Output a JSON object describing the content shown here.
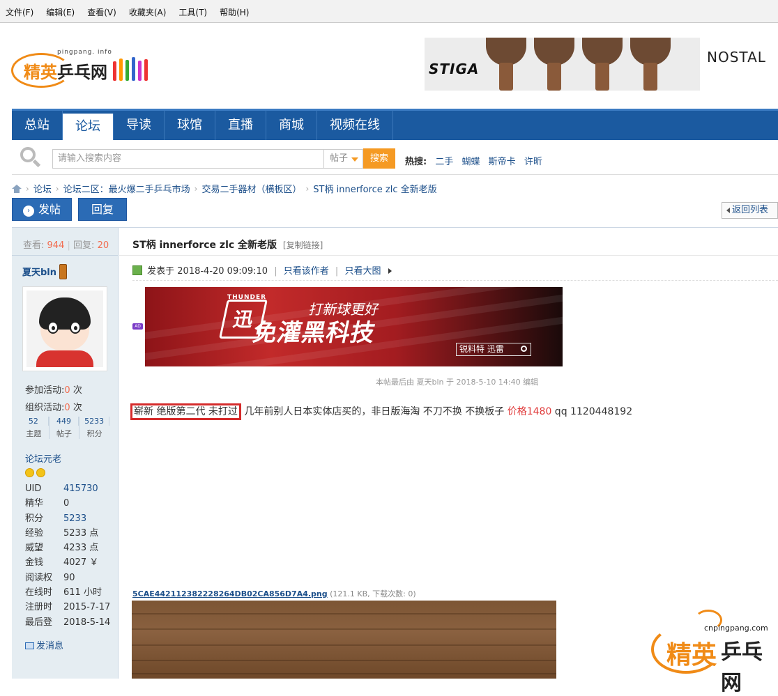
{
  "menubar": {
    "items": [
      "文件(F)",
      "编辑(E)",
      "查看(V)",
      "收藏夹(A)",
      "工具(T)",
      "帮助(H)"
    ]
  },
  "logo": {
    "site": "pingpang. info",
    "jing": "精英",
    "pp": "乒乓网"
  },
  "ad_top": {
    "brand": "STIGA",
    "side_text": "NOSTAL"
  },
  "nav": {
    "items": [
      "总站",
      "论坛",
      "导读",
      "球馆",
      "直播",
      "商城",
      "视频在线"
    ],
    "active": "论坛"
  },
  "search": {
    "placeholder": "请输入搜索内容",
    "type": "帖子",
    "button": "搜索",
    "hot_label": "热搜:",
    "hot_items": [
      "二手",
      "蝴蝶",
      "斯帝卡",
      "许昕"
    ]
  },
  "breadcrumb": {
    "items": [
      "论坛",
      "论坛二区：最火爆二手乒乓市场",
      "交易二手器材（横板区）",
      "ST柄 innerforce zlc 全新老版"
    ]
  },
  "actions": {
    "post": "发帖",
    "reply": "回复",
    "back": "返回列表"
  },
  "sidebar": {
    "views_label": "查看:",
    "views": "944",
    "replies_label": "回复:",
    "replies": "20",
    "username": "夏天bln",
    "activity_participate_label": "参加活动:",
    "activity_participate": "0",
    "activity_organize_label": "组织活动:",
    "activity_organize": "0",
    "activity_unit": "次",
    "counts": [
      {
        "n": "52",
        "l": "主题"
      },
      {
        "n": "449",
        "l": "帖子"
      },
      {
        "n": "5233",
        "l": "积分"
      }
    ],
    "rank": "论坛元老",
    "info": [
      {
        "k": "UID",
        "v": "415730"
      },
      {
        "k": "精华",
        "v": "0"
      },
      {
        "k": "积分",
        "v": "5233"
      },
      {
        "k": "经验",
        "v": "5233 点"
      },
      {
        "k": "威望",
        "v": "4233 点"
      },
      {
        "k": "金钱",
        "v": "4027 ￥"
      },
      {
        "k": "阅读权",
        "v": "90"
      },
      {
        "k": "在线时",
        "v": "611 小时"
      },
      {
        "k": "注册时",
        "v": "2015-7-17"
      },
      {
        "k": "最后登",
        "v": "2018-5-14"
      }
    ],
    "send_message": "发消息"
  },
  "post": {
    "title": "ST柄 innerforce zlc 全新老版",
    "copy_link": "[复制链接]",
    "posted": "发表于 2018-4-20 09:09:10",
    "only_author": "只看该作者",
    "only_large": "只看大图",
    "ad_badge": "AD",
    "ad": {
      "brand": "THUNDER",
      "slogan": "打新球更好",
      "main": "免灌黑科技",
      "search": "锐料特 迅雷"
    },
    "edited": "本帖最后由 夏天bln 于 2018-5-10 14:40 编辑",
    "highlight": "崭新 绝版第二代 未打过",
    "body": " 几年前别人日本实体店买的，非日版海淘   不刀不换 不换板子 ",
    "price": "价格1480",
    "qq": "   qq 1120448192",
    "attachment_name": "5CAE442112382228264DB02CA856D7A4.png",
    "attachment_info": " (121.1 KB, 下载次数: 0)"
  },
  "watermark": {
    "site": "cnpingpang.com",
    "jing": "精英",
    "pp": "乒乓网"
  },
  "colors": {
    "nav": "#1b5aa0",
    "accent": "#f59a23",
    "link": "#1c4f8a",
    "highlight_border": "#d52b2b"
  }
}
